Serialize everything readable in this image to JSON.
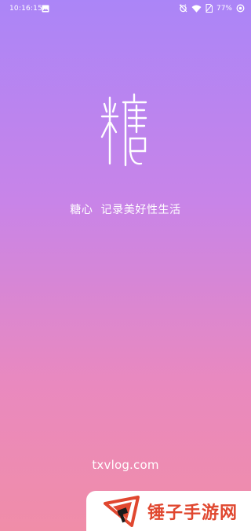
{
  "status_bar": {
    "time": "10:16:15",
    "battery": "77%",
    "icons": [
      "image-icon",
      "alarm-off-icon",
      "wifi-icon",
      "no-sim-icon",
      "battery-saver-icon"
    ]
  },
  "splash": {
    "logo_text": "糖",
    "tagline": "糖心  记录美好性生活",
    "website": "txvlog.com"
  },
  "watermark": {
    "text": "锤子手游网"
  },
  "colors": {
    "gradient_top": "#ab85f7",
    "gradient_bottom": "#f08da8",
    "watermark_red": "#e0472f"
  }
}
